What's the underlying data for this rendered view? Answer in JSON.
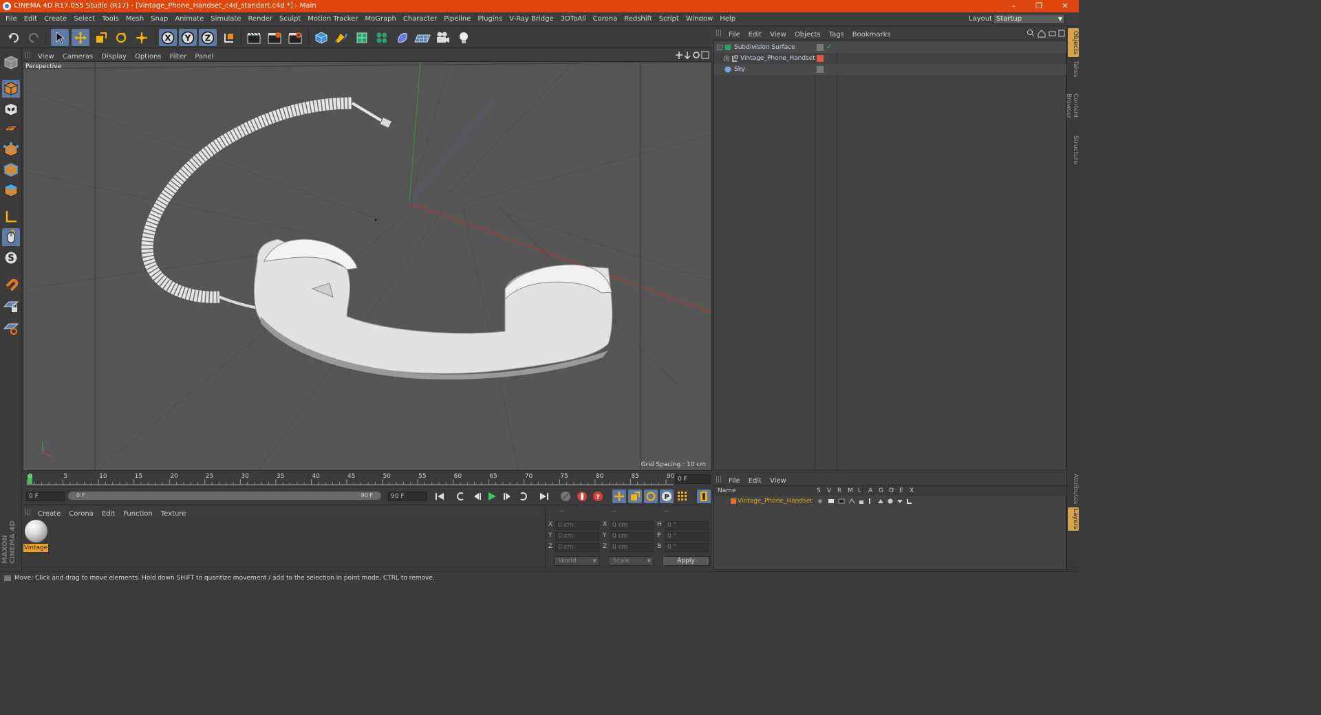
{
  "window": {
    "title": "CINEMA 4D R17.055 Studio (R17) - [Vintage_Phone_Handset_c4d_standart.c4d *] - Main",
    "minimize": "–",
    "restore": "❐",
    "close": "✕"
  },
  "menubar": {
    "items": [
      "File",
      "Edit",
      "Create",
      "Select",
      "Tools",
      "Mesh",
      "Snap",
      "Animate",
      "Simulate",
      "Render",
      "Sculpt",
      "Motion Tracker",
      "MoGraph",
      "Character",
      "Pipeline",
      "Plugins",
      "V-Ray Bridge",
      "3DToAll",
      "Corona",
      "Redshift",
      "Script",
      "Window",
      "Help"
    ],
    "layout_label": "Layout:",
    "layout_value": "Startup"
  },
  "viewport": {
    "menu": [
      "View",
      "Cameras",
      "Display",
      "Options",
      "Filter",
      "Panel"
    ],
    "label": "Perspective",
    "grid_spacing": "Grid Spacing : 10 cm"
  },
  "timeline": {
    "ticks": [
      "0",
      "5",
      "10",
      "15",
      "20",
      "25",
      "30",
      "35",
      "40",
      "45",
      "50",
      "55",
      "60",
      "65",
      "70",
      "75",
      "80",
      "85",
      "90"
    ],
    "end_field": "0 F",
    "start_field": "0 F",
    "range_start": "0 F",
    "range_end": "90 F",
    "max_field": "90 F"
  },
  "material_manager": {
    "menu": [
      "Create",
      "Corona",
      "Edit",
      "Function",
      "Texture"
    ],
    "materials": [
      {
        "name": "Vintage"
      }
    ]
  },
  "coordinates": {
    "header": [
      "--",
      "--",
      "--"
    ],
    "rows": [
      {
        "a": "X",
        "av": "0 cm",
        "b": "X",
        "bv": "0 cm",
        "c": "H",
        "cv": "0 °"
      },
      {
        "a": "Y",
        "av": "0 cm",
        "b": "Y",
        "bv": "0 cm",
        "c": "P",
        "cv": "0 °"
      },
      {
        "a": "Z",
        "av": "0 cm",
        "b": "Z",
        "bv": "0 cm",
        "c": "B",
        "cv": "0 °"
      }
    ],
    "mode": "World",
    "size_mode": "Scale",
    "apply": "Apply"
  },
  "object_manager": {
    "menu": [
      "File",
      "Edit",
      "View",
      "Objects",
      "Tags",
      "Bookmarks"
    ],
    "objects": [
      {
        "name": "Subdivision Surface"
      },
      {
        "name": "Vintage_Phone_Handset"
      },
      {
        "name": "Sky"
      }
    ]
  },
  "layer_manager": {
    "menu": [
      "File",
      "Edit",
      "View"
    ],
    "header": {
      "name": "Name",
      "cols": [
        "S",
        "V",
        "R",
        "M",
        "L",
        "A",
        "G",
        "D",
        "E",
        "X"
      ]
    },
    "layers": [
      {
        "name": "Vintage_Phone_Handset",
        "color": "#e0702a"
      }
    ]
  },
  "right_tabs": [
    "Objects",
    "Takes",
    "Content Browser",
    "Structure",
    "Attributes",
    "Layers"
  ],
  "branding": "MAXON CINEMA 4D",
  "status": "Move: Click and drag to move elements. Hold down SHIFT to quantize movement / add to the selection in point mode, CTRL to remove.",
  "colors": {
    "accent": "#e0470c",
    "active_tool": "#5e7aa3",
    "material_label": "#f0a020"
  }
}
